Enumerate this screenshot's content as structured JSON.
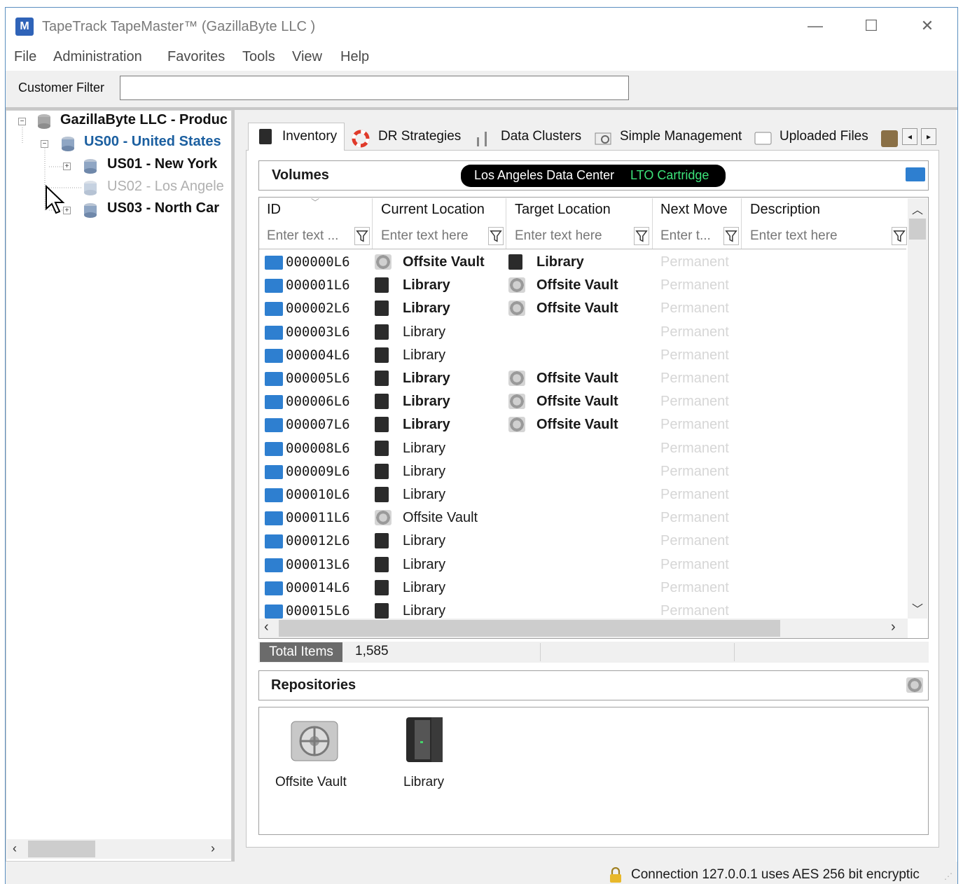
{
  "window": {
    "title": "TapeTrack TapeMaster™ (GazillaByte LLC )",
    "icon": "M",
    "min_glyph": "—",
    "max_glyph": "☐",
    "close_glyph": "✕"
  },
  "menu": [
    "File",
    "Administration",
    "Favorites",
    "Tools",
    "View",
    "Help"
  ],
  "customer_filter": {
    "label": "Customer Filter",
    "value": ""
  },
  "tree": {
    "root": "GazillaByte LLC  - Produc",
    "us00": "US00 - United States",
    "us01": "US01 - New York",
    "us02": "US02 - Los Angele",
    "us03": "US03 - North Car"
  },
  "tabs": [
    "Inventory",
    "DR Strategies",
    "Data Clusters",
    "Simple Management",
    "Uploaded Files"
  ],
  "volumes": {
    "title": "Volumes",
    "location": "Los Angeles Data Center",
    "media_type": "LTO Cartridge"
  },
  "grid": {
    "columns": [
      "ID",
      "Current Location",
      "Target Location",
      "Next Move",
      "Description"
    ],
    "filter_placeholders": [
      "Enter text ...",
      "Enter text here",
      "Enter text here",
      "Enter t...",
      "Enter text here"
    ],
    "rows": [
      {
        "id": "000000L6",
        "current": "Offsite Vault",
        "current_icon": "vault",
        "current_bold": true,
        "target": "Library",
        "target_icon": "library",
        "next": "Permanent"
      },
      {
        "id": "000001L6",
        "current": "Library",
        "current_icon": "library",
        "current_bold": true,
        "target": "Offsite Vault",
        "target_icon": "vault",
        "next": "Permanent"
      },
      {
        "id": "000002L6",
        "current": "Library",
        "current_icon": "library",
        "current_bold": true,
        "target": "Offsite Vault",
        "target_icon": "vault",
        "next": "Permanent"
      },
      {
        "id": "000003L6",
        "current": "Library",
        "current_icon": "library",
        "current_bold": false,
        "target": "",
        "target_icon": "",
        "next": "Permanent"
      },
      {
        "id": "000004L6",
        "current": "Library",
        "current_icon": "library",
        "current_bold": false,
        "target": "",
        "target_icon": "",
        "next": "Permanent"
      },
      {
        "id": "000005L6",
        "current": "Library",
        "current_icon": "library",
        "current_bold": true,
        "target": "Offsite Vault",
        "target_icon": "vault",
        "next": "Permanent"
      },
      {
        "id": "000006L6",
        "current": "Library",
        "current_icon": "library",
        "current_bold": true,
        "target": "Offsite Vault",
        "target_icon": "vault",
        "next": "Permanent"
      },
      {
        "id": "000007L6",
        "current": "Library",
        "current_icon": "library",
        "current_bold": true,
        "target": "Offsite Vault",
        "target_icon": "vault",
        "next": "Permanent"
      },
      {
        "id": "000008L6",
        "current": "Library",
        "current_icon": "library",
        "current_bold": false,
        "target": "",
        "target_icon": "",
        "next": "Permanent"
      },
      {
        "id": "000009L6",
        "current": "Library",
        "current_icon": "library",
        "current_bold": false,
        "target": "",
        "target_icon": "",
        "next": "Permanent"
      },
      {
        "id": "000010L6",
        "current": "Library",
        "current_icon": "library",
        "current_bold": false,
        "target": "",
        "target_icon": "",
        "next": "Permanent"
      },
      {
        "id": "000011L6",
        "current": "Offsite Vault",
        "current_icon": "vault",
        "current_bold": false,
        "target": "",
        "target_icon": "",
        "next": "Permanent"
      },
      {
        "id": "000012L6",
        "current": "Library",
        "current_icon": "library",
        "current_bold": false,
        "target": "",
        "target_icon": "",
        "next": "Permanent"
      },
      {
        "id": "000013L6",
        "current": "Library",
        "current_icon": "library",
        "current_bold": false,
        "target": "",
        "target_icon": "",
        "next": "Permanent"
      },
      {
        "id": "000014L6",
        "current": "Library",
        "current_icon": "library",
        "current_bold": false,
        "target": "",
        "target_icon": "",
        "next": "Permanent"
      },
      {
        "id": "000015L6",
        "current": "Library",
        "current_icon": "library",
        "current_bold": false,
        "target": "",
        "target_icon": "",
        "next": "Permanent"
      }
    ]
  },
  "totals": {
    "label": "Total Items",
    "value": "1,585"
  },
  "repositories": {
    "title": "Repositories",
    "items": [
      {
        "label": "Offsite Vault",
        "icon": "vault-icon"
      },
      {
        "label": "Library",
        "icon": "library-icon"
      }
    ]
  },
  "status": {
    "connection": "Connection 127.0.0.1 uses AES 256 bit encryptic"
  },
  "colors": {
    "accent": "#2e7fd0",
    "pill_bg": "#000000",
    "pill_type": "#3ce37a",
    "us00": "#1b5fa0",
    "disabled": "#b0b0b0"
  }
}
